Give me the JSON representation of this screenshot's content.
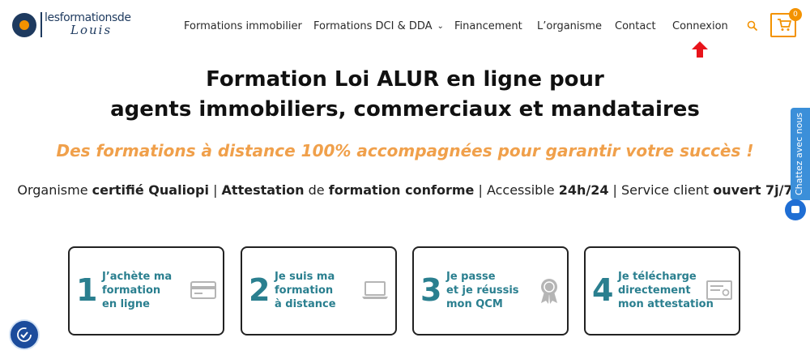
{
  "logo": {
    "top": "lesformationsde",
    "bottom": "Louis"
  },
  "nav": {
    "items": [
      {
        "label": "Formations immobilier"
      },
      {
        "label": "Formations DCI & DDA"
      },
      {
        "label": "Financement"
      },
      {
        "label": "L’organisme"
      },
      {
        "label": "Contact"
      },
      {
        "label": "Connexion"
      }
    ]
  },
  "cart": {
    "count": "0"
  },
  "hero": {
    "title_line1": "Formation Loi ALUR en ligne pour",
    "title_line2": "agents immobiliers, commerciaux et mandataires",
    "subtitle": "Des formations à distance 100% accompagnées pour garantir votre succès !",
    "badges": {
      "p1": "Organisme ",
      "b1": "certifié Qualiopi",
      "sep1": " | ",
      "b2": "Attestation",
      "p2": " de ",
      "b3": "formation conforme",
      "sep2": " | Accessible ",
      "b4": "24h/24",
      "sep3": " | Service client ",
      "b5": "ouvert 7j/7"
    }
  },
  "steps": [
    {
      "number": "1",
      "line1": "J’achète ma",
      "line2": "formation",
      "line3": "en ligne",
      "icon": "credit-card-icon"
    },
    {
      "number": "2",
      "line1": "Je suis ma",
      "line2": "formation",
      "line3": "à distance",
      "icon": "laptop-icon"
    },
    {
      "number": "3",
      "line1": "Je passe",
      "line2": "et je réussis",
      "line3": "mon QCM",
      "icon": "award-ribbon-icon"
    },
    {
      "number": "4",
      "line1": "Je télécharge",
      "line2": "directement",
      "line3": "mon attestation",
      "icon": "certificate-icon"
    }
  ],
  "chat": {
    "tab_label": "Chattez avec nous"
  },
  "colors": {
    "accent": "#f39200",
    "teal": "#2a7f8f",
    "subtitle": "#f0a04b",
    "chat": "#3b8fd9"
  }
}
